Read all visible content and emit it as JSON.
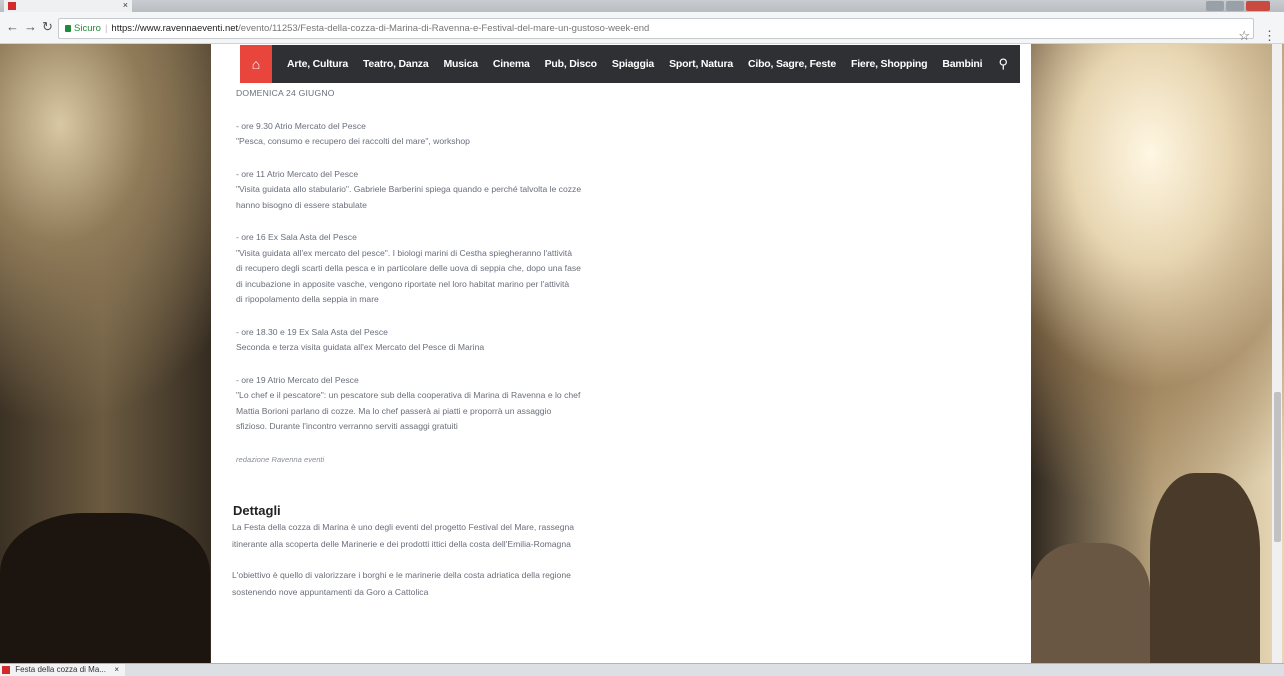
{
  "browser": {
    "tab_title": "",
    "tab_close": "×",
    "url_secure_label": "Sicuro",
    "url_host": "https://www.ravennaeventi.net",
    "url_path": "/evento/11253/Festa-della-cozza-di-Marina-di-Ravenna-e-Festival-del-mare-un-gustoso-week-end",
    "back_icon": "arrow-left-icon",
    "forward_icon": "arrow-right-icon",
    "reload_icon": "reload-icon",
    "star_icon": "star-icon",
    "menu_icon": "kebab-menu-icon"
  },
  "nav": {
    "home_icon": "home-icon",
    "items": [
      "Arte, Cultura",
      "Teatro, Danza",
      "Musica",
      "Cinema",
      "Pub, Disco",
      "Spiaggia",
      "Sport, Natura",
      "Cibo, Sagre, Feste",
      "Fiere, Shopping",
      "Bambini"
    ],
    "search_icon": "search-icon"
  },
  "article": {
    "dateline": "DOMENICA 24 GIUGNO",
    "events": [
      {
        "time_place": "- ore 9.30 Atrio Mercato del Pesce",
        "desc": [
          "\"Pesca, consumo e recupero dei raccolti del mare\", workshop"
        ]
      },
      {
        "time_place": "- ore 11 Atrio Mercato del Pesce",
        "desc": [
          "\"Visita guidata allo stabulario\". Gabriele Barberini spiega quando e perché talvolta le cozze",
          "hanno bisogno di essere stabulate"
        ]
      },
      {
        "time_place": "- ore 16 Ex Sala Asta del Pesce",
        "desc": [
          "\"Visita guidata all'ex mercato del pesce\". I biologi marini di Cestha spiegheranno l'attività",
          "di recupero degli scarti della pesca e in particolare delle uova di seppia che, dopo una fase",
          "di incubazione in apposite vasche, vengono riportate nel loro habitat marino per l'attività",
          "di ripopolamento della seppia in mare"
        ]
      },
      {
        "time_place": "- ore 18.30 e 19 Ex Sala Asta del Pesce",
        "desc": [
          "Seconda e terza visita guidata all'ex Mercato del Pesce di Marina"
        ]
      },
      {
        "time_place": "- ore 19 Atrio Mercato del Pesce",
        "desc": [
          "\"Lo chef e il pescatore\": un pescatore sub della cooperativa di Marina di Ravenna e lo chef",
          "Mattia Borioni parlano di cozze. Ma lo chef passerà ai piatti e proporrà un assaggio",
          "sfizioso. Durante l'incontro verranno serviti assaggi gratuiti"
        ]
      }
    ],
    "credit": "redazione Ravenna eventi"
  },
  "dettagli": {
    "title": "Dettagli",
    "p1": [
      "La Festa della cozza di Marina è uno degli eventi del progetto Festival del Mare, rassegna",
      "itinerante alla scoperta delle Marinerie e dei prodotti ittici della costa dell'Emilia-Romagna"
    ],
    "p2": [
      "L'obiettivo è quello di valorizzare i borghi e le marinerie della costa adriatica della regione",
      "sostenendo nove appuntamenti da Goro a Cattolica"
    ]
  },
  "taskbar": {
    "tab_title": "Festa della cozza di Ma...",
    "tab_close": "×"
  }
}
